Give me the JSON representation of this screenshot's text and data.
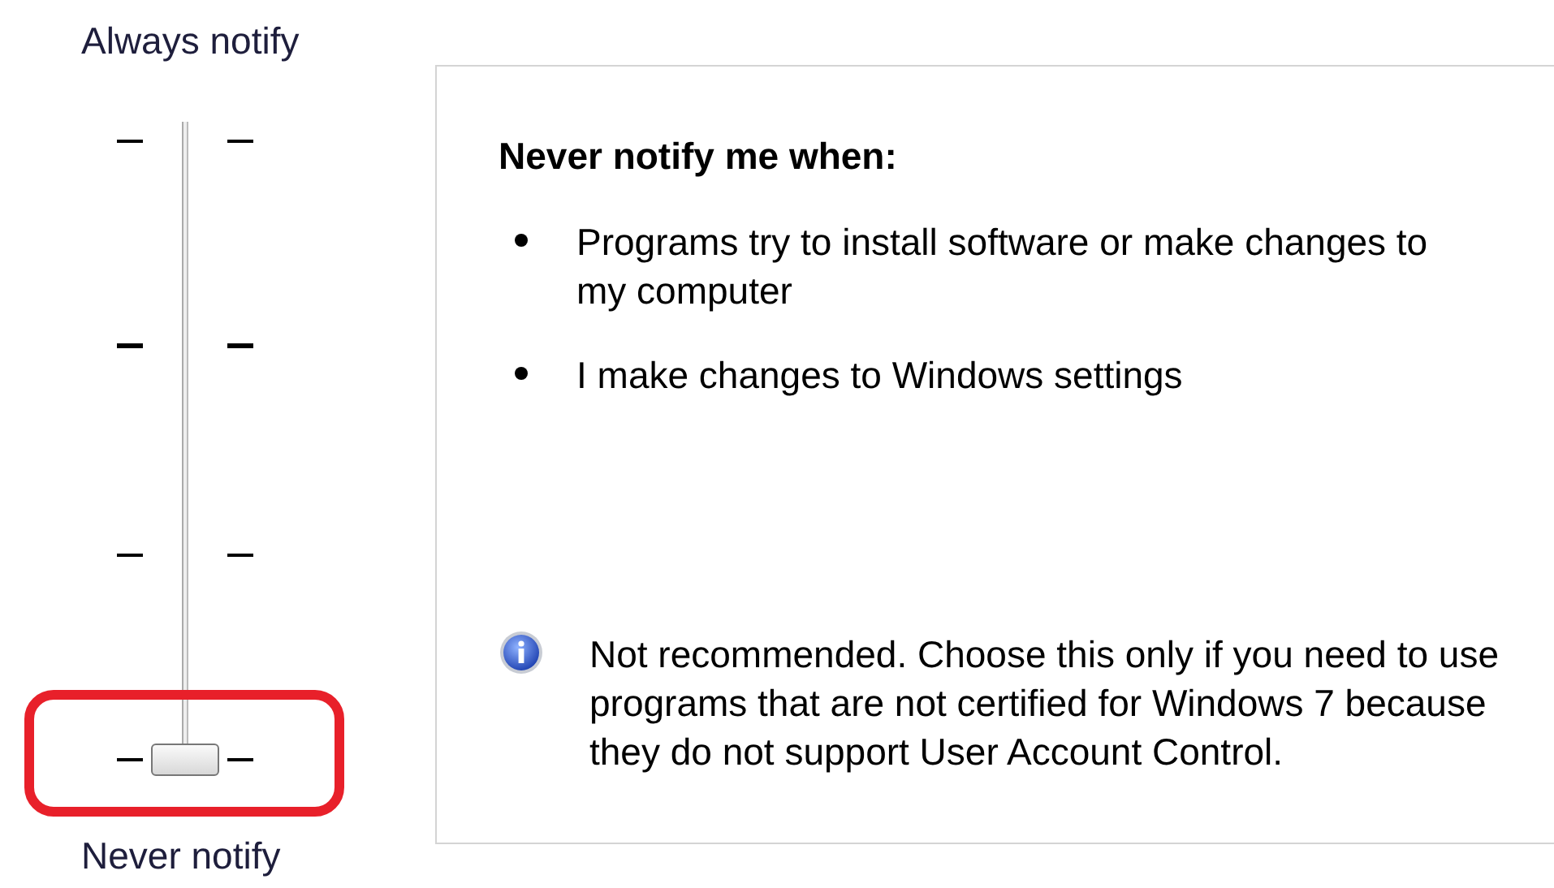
{
  "slider": {
    "top_label": "Always notify",
    "bottom_label": "Never notify",
    "level": 0
  },
  "panel": {
    "heading": "Never notify me when:",
    "bullets": [
      "Programs try to install software or make changes to my computer",
      "I make changes to Windows settings"
    ],
    "note": "Not recommended. Choose this only if you need to use programs that are not certified for Windows 7 because they do not support User Account Control."
  }
}
